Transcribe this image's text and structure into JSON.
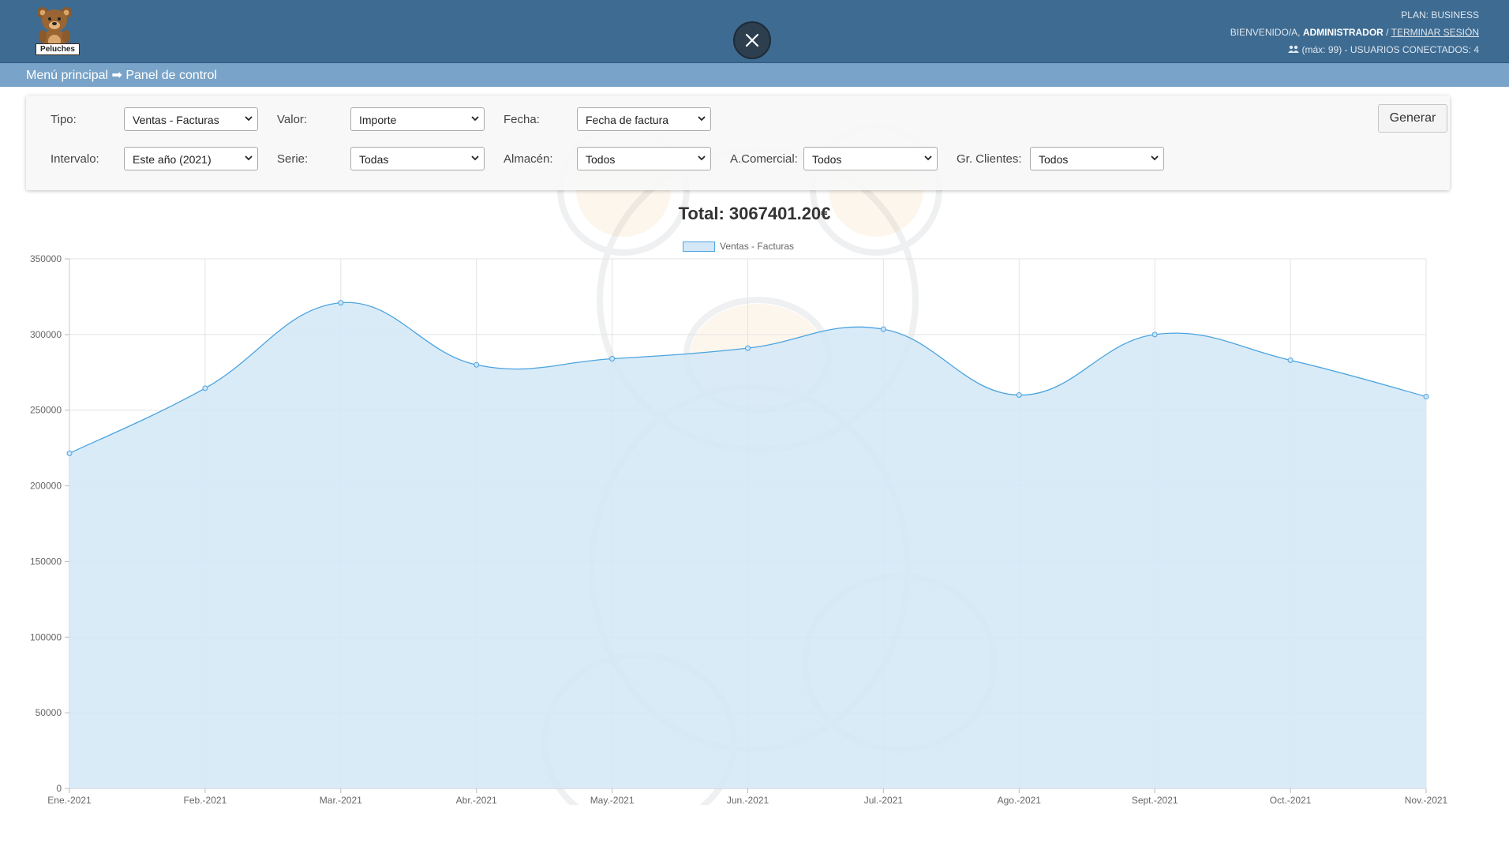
{
  "header": {
    "logo_text": "Peluches",
    "plan_text": "PLAN: BUSINESS",
    "welcome_prefix": "BIENVENIDO/A,",
    "username": "ADMINISTRADOR",
    "logout_label": "TERMINAR SESIÓN",
    "users_text": "(máx: 99) - USUARIOS CONECTADOS: 4"
  },
  "breadcrumb": {
    "text": "Menú principal ➡ Panel de control"
  },
  "filters": {
    "tipo_label": "Tipo:",
    "tipo_value": "Ventas - Facturas",
    "valor_label": "Valor:",
    "valor_value": "Importe",
    "fecha_label": "Fecha:",
    "fecha_value": "Fecha de factura",
    "intervalo_label": "Intervalo:",
    "intervalo_value": "Este año (2021)",
    "serie_label": "Serie:",
    "serie_value": "Todas",
    "almacen_label": "Almacén:",
    "almacen_value": "Todos",
    "comercial_label": "A.Comercial:",
    "comercial_value": "Todos",
    "clientes_label": "Gr. Clientes:",
    "clientes_value": "Todos",
    "generate_label": "Generar"
  },
  "colors": {
    "header_bg": "#3e6b91",
    "breadcrumb_bg": "#79a3c8",
    "series_line": "#4aa4e0",
    "series_fill": "#d4e7f7"
  },
  "chart_data": {
    "type": "area",
    "title": "Total: 3067401.20€",
    "xlabel": "",
    "ylabel": "",
    "legend_position": "top-center",
    "grid": true,
    "categories": [
      "Ene.-2021",
      "Feb.-2021",
      "Mar.-2021",
      "Abr.-2021",
      "May.-2021",
      "Jun.-2021",
      "Jul.-2021",
      "Ago.-2021",
      "Sept.-2021",
      "Oct.-2021",
      "Nov.-2021"
    ],
    "series": [
      {
        "name": "Ventas - Facturas",
        "values": [
          221500,
          264500,
          321000,
          280000,
          284000,
          291000,
          303500,
          260000,
          300000,
          283000,
          259000
        ]
      }
    ],
    "ylim": [
      0,
      350000
    ],
    "yticks": [
      0,
      50000,
      100000,
      150000,
      200000,
      250000,
      300000,
      350000
    ]
  }
}
